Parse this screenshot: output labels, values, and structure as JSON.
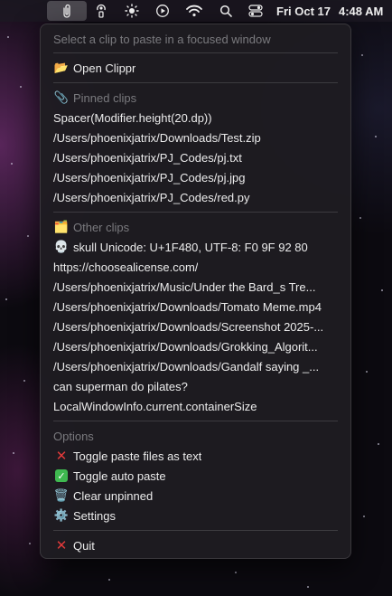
{
  "menubar": {
    "clock_date": "Fri Oct 17",
    "clock_time": "4:48 AM",
    "icons": [
      "clip-icon",
      "airdrop-icon",
      "brightness-icon",
      "play-icon",
      "wifi-icon",
      "search-icon",
      "control-center-icon"
    ]
  },
  "menu": {
    "hint": "Select a clip to paste in a focused window",
    "open_label": "Open Clippr",
    "pinned_header": "Pinned clips",
    "pinned": [
      "Spacer(Modifier.height(20.dp))",
      "/Users/phoenixjatrix/Downloads/Test.zip",
      "/Users/phoenixjatrix/PJ_Codes/pj.txt",
      "/Users/phoenixjatrix/PJ_Codes/pj.jpg",
      "/Users/phoenixjatrix/PJ_Codes/red.py"
    ],
    "other_header": "Other clips",
    "other": [
      "skull Unicode: U+1F480, UTF-8: F0 9F 92 80",
      "https://choosealicense.com/",
      "/Users/phoenixjatrix/Music/Under the Bard_s Tre...",
      "/Users/phoenixjatrix/Downloads/Tomato Meme.mp4",
      "/Users/phoenixjatrix/Downloads/Screenshot 2025-...",
      "/Users/phoenixjatrix/Downloads/Grokking_Algorit...",
      "/Users/phoenixjatrix/Downloads/Gandalf saying _...",
      "can superman do pilates?",
      "LocalWindowInfo.current.containerSize"
    ],
    "options_header": "Options",
    "options": [
      "Toggle paste files as text",
      "Toggle auto paste",
      "Clear unpinned",
      "Settings"
    ],
    "quit_label": "Quit"
  },
  "colors": {
    "menu_bg": "#1e1c21",
    "disabled_text": "#7a7a7e",
    "accent_red": "#e23a3a",
    "accent_green": "#3fb950"
  }
}
